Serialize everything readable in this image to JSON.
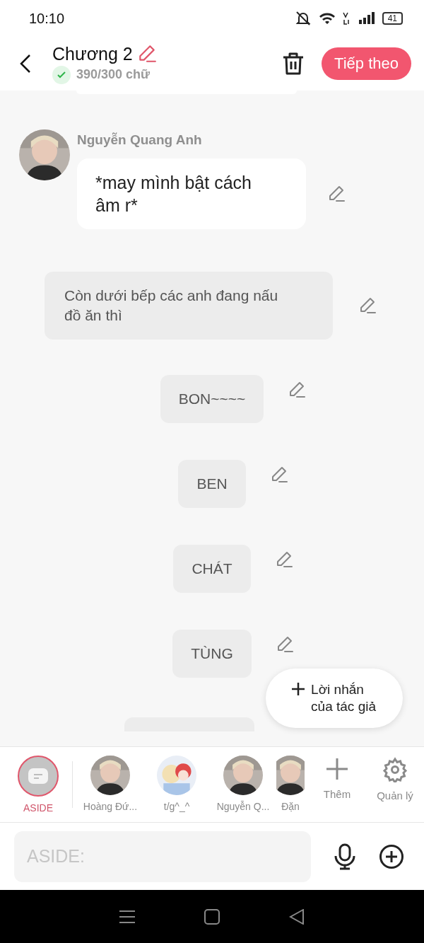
{
  "status_bar": {
    "time": "10:10",
    "battery": "41"
  },
  "header": {
    "title": "Chương 2",
    "word_count": "390/300 chữ",
    "count_ok": true,
    "next_button": "Tiếp theo"
  },
  "messages": [
    {
      "kind": "character",
      "name": "Nguyễn Quang Anh",
      "text": "*may mình bật cách âm r*"
    },
    {
      "kind": "narration",
      "text": "Còn dưới bếp các anh đang nấu đồ ăn thì"
    },
    {
      "kind": "aside",
      "text": "BON~~~~"
    },
    {
      "kind": "aside",
      "text": "BEN"
    },
    {
      "kind": "aside",
      "text": "CHÁT"
    },
    {
      "kind": "aside",
      "text": "TÙNG"
    }
  ],
  "author_note_button": {
    "line1": "Lời nhắn",
    "line2": "của tác giả"
  },
  "characters": [
    {
      "kind": "aside",
      "name": "ASIDE",
      "selected": true
    },
    {
      "kind": "person",
      "name": "Hoàng Đứ...",
      "selected": false
    },
    {
      "kind": "drawing",
      "name": "t/g^_^",
      "selected": false
    },
    {
      "kind": "person",
      "name": "Nguyễn Q...",
      "selected": false
    },
    {
      "kind": "person",
      "name": "Đặn",
      "selected": false
    }
  ],
  "character_actions": [
    {
      "kind": "add",
      "label": "Thêm"
    },
    {
      "kind": "settings",
      "label": "Quản lý"
    }
  ],
  "composer": {
    "placeholder": "ASIDE:"
  }
}
